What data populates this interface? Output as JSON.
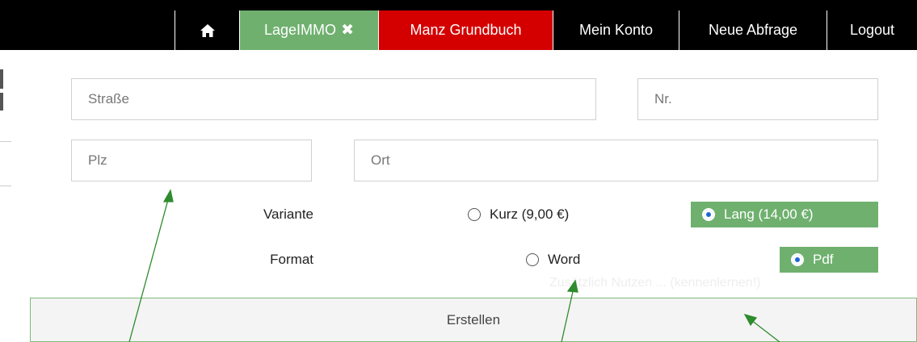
{
  "nav": {
    "home_icon": "home-icon",
    "items": [
      {
        "label": "LageIMMO",
        "close_glyph": "✖"
      },
      {
        "label": "Manz Grundbuch"
      },
      {
        "label": "Mein Konto"
      },
      {
        "label": "Neue Abfrage"
      },
      {
        "label": "Logout"
      }
    ]
  },
  "form": {
    "street_placeholder": "Straße",
    "number_placeholder": "Nr.",
    "zip_placeholder": "Plz",
    "city_placeholder": "Ort",
    "variante_label": "Variante",
    "variante_options": [
      {
        "label": "Kurz (9,00 €)",
        "selected": false
      },
      {
        "label": "Lang (14,00 €)",
        "selected": true
      }
    ],
    "format_label": "Format",
    "format_options": [
      {
        "label": "Word",
        "selected": false
      },
      {
        "label": "Pdf",
        "selected": true
      }
    ],
    "ghost_text": "Zusätzlich Nutzen ... (kennenlernen!)",
    "submit_label": "Erstellen"
  },
  "colors": {
    "nav_bg": "#000000",
    "lageimmo_bg": "#6fb06f",
    "manz_bg": "#d40000",
    "selected_option_bg": "#6fb06f",
    "radio_selected": "#1e66d6",
    "annotation_arrow": "#2e8b2e"
  }
}
